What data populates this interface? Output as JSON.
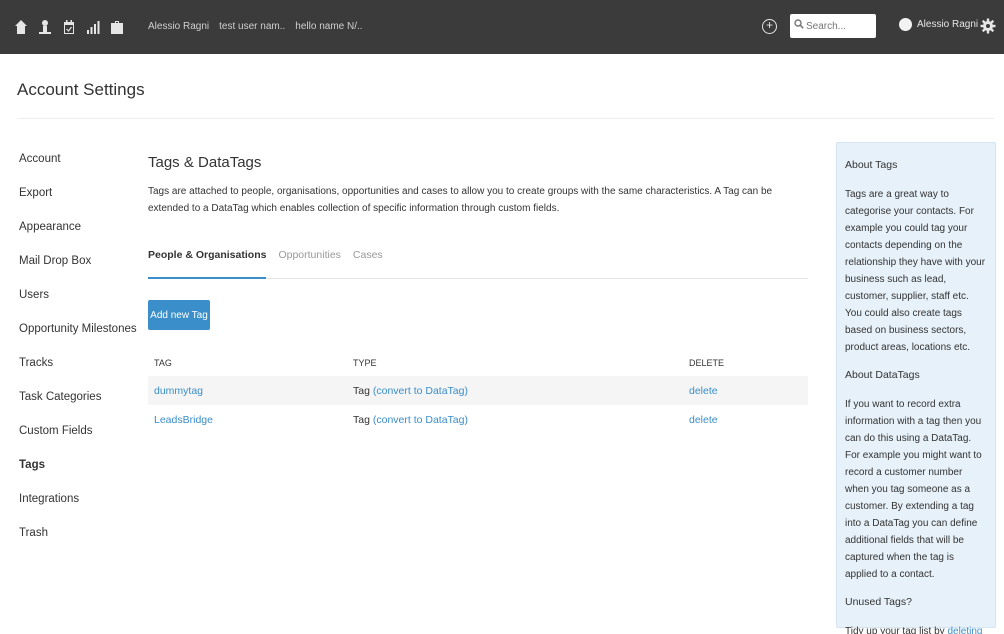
{
  "topbar": {
    "nav_icons": [
      "home-icon",
      "person-icon",
      "calendar-icon",
      "chart-icon",
      "briefcase-icon"
    ],
    "crumbs": [
      "Alessio Ragni",
      "test user nam..",
      "hello name N/.."
    ],
    "search_placeholder": "Search...",
    "user_name": "Alessio Ragni",
    "caret": "▾",
    "plus": "+"
  },
  "page": {
    "title": "Account Settings"
  },
  "sidebar": {
    "items": [
      {
        "label": "Account"
      },
      {
        "label": "Export"
      },
      {
        "label": "Appearance"
      },
      {
        "label": "Mail Drop Box"
      },
      {
        "label": "Users"
      },
      {
        "label": "Opportunity Milestones"
      },
      {
        "label": "Tracks"
      },
      {
        "label": "Task Categories"
      },
      {
        "label": "Custom Fields"
      },
      {
        "label": "Tags",
        "active": true
      },
      {
        "label": "Integrations"
      },
      {
        "label": "Trash"
      }
    ]
  },
  "main": {
    "title": "Tags & DataTags",
    "description": "Tags are attached to people, organisations, opportunities and cases to allow you to create groups with the same characteristics. A Tag can be extended to a DataTag which enables collection of specific information through custom fields.",
    "tabs": [
      {
        "label": "People & Organisations",
        "active": true
      },
      {
        "label": "Opportunities"
      },
      {
        "label": "Cases"
      }
    ],
    "add_button": "Add new Tag",
    "table": {
      "headers": [
        "TAG",
        "TYPE",
        "DELETE"
      ],
      "rows": [
        {
          "tag": "dummytag",
          "type": "Tag",
          "convert": "(convert to DataTag)",
          "delete": "delete"
        },
        {
          "tag": "LeadsBridge",
          "type": "Tag",
          "convert": "(convert to DataTag)",
          "delete": "delete"
        }
      ]
    }
  },
  "info": {
    "about_tags_title": "About Tags",
    "about_tags_text": "Tags are a great way to categorise your contacts. For example you could tag your contacts depending on the relationship they have with your business such as lead, customer, supplier, staff etc. You could also create tags based on business sectors, product areas, locations etc.",
    "about_datatags_title": "About DataTags",
    "about_datatags_text": "If you want to record extra information with a tag then you can do this using a DataTag. For example you might want to record a customer number when you tag someone as a customer. By extending a tag into a DataTag you can define additional fields that will be captured when the tag is applied to a contact.",
    "unused_title": "Unused Tags?",
    "unused_prefix": "Tidy up your tag list by ",
    "unused_link": "deleting unused tags",
    "unused_suffix": "."
  },
  "colors": {
    "topbar": "#3b3b3b",
    "accent": "#3a8ec9",
    "info_bg": "#e7f1f9"
  }
}
